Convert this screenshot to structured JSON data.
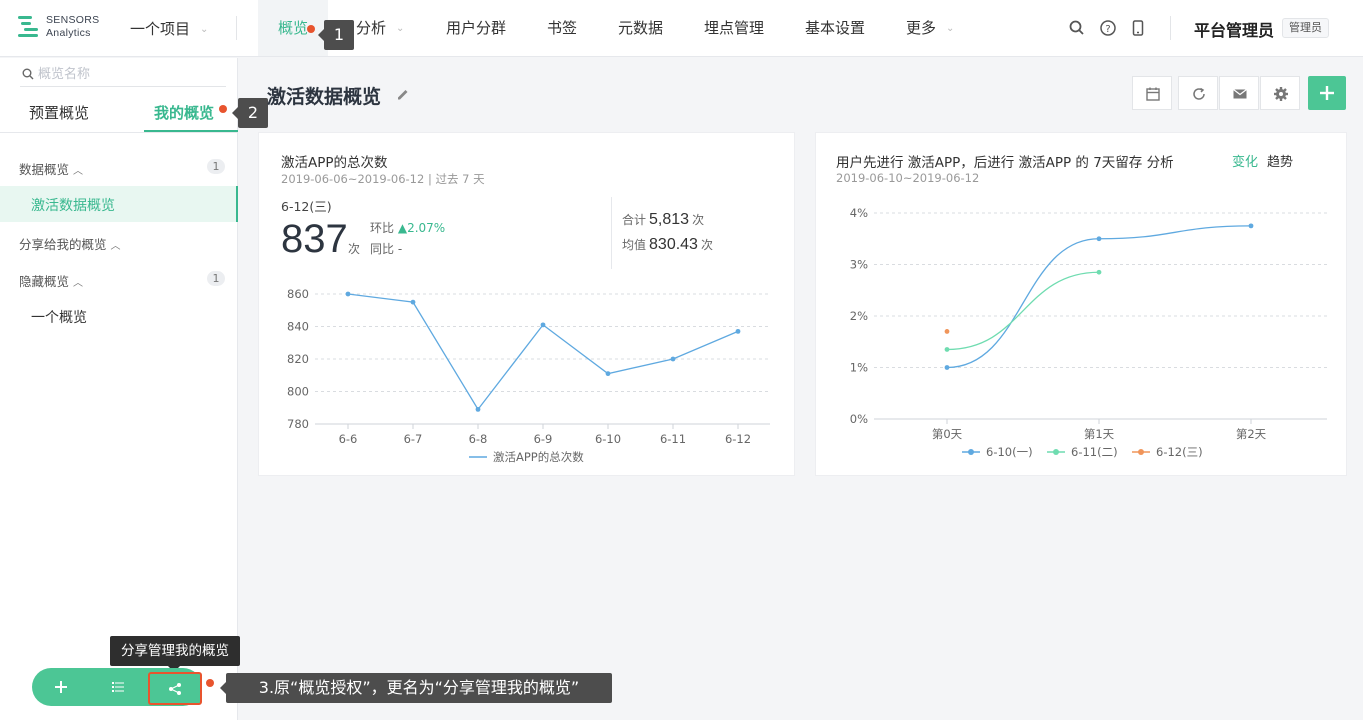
{
  "brand": {
    "line1": "SENSORS",
    "line2": "Analytics",
    "color": "#39b88f"
  },
  "header": {
    "project": "一个项目",
    "nav": [
      "概览",
      "分析",
      "用户分群",
      "书签",
      "元数据",
      "埋点管理",
      "基本设置",
      "更多"
    ],
    "icons": [
      "search-icon",
      "help-icon",
      "mobile-icon"
    ],
    "user": "平台管理员",
    "role": "管理员"
  },
  "annotations": {
    "one": "1",
    "two": "2",
    "three": "3.原“概览授权”，更名为“分享管理我的概览”",
    "tooltip": "分享管理我的概览"
  },
  "sidebar": {
    "search_placeholder": "概览名称",
    "tabs": [
      "预置概览",
      "我的概览"
    ],
    "groups": [
      {
        "label": "数据概览",
        "count": "1",
        "items": [
          "激活数据概览"
        ]
      },
      {
        "label": "分享给我的概览",
        "count": "",
        "items": []
      },
      {
        "label": "隐藏概览",
        "count": "1",
        "items": [
          "一个概览"
        ]
      }
    ]
  },
  "main": {
    "title": "激活数据概览",
    "toolbar": [
      "calendar-icon",
      "refresh-icon",
      "mail-icon",
      "gear-icon",
      "plus-icon"
    ]
  },
  "card1": {
    "title": "激活APP的总次数",
    "subtitle": "2019-06-06~2019-06-12 | 过去 7 天",
    "date": "6-12(三)",
    "value": "837",
    "unit": "次",
    "mom_label": "环比",
    "mom_value": "▲2.07%",
    "yoy": "同比 -",
    "total_label": "合计",
    "total": "5,813",
    "avg_label": "均值",
    "avg": "830.43"
  },
  "card2": {
    "title": "用户先进行 激活APP，后进行 激活APP 的 7天留存 分析",
    "subtitle": "2019-06-10~2019-06-12",
    "toggle": [
      "变化",
      "趋势"
    ]
  },
  "chart_data": [
    {
      "type": "line",
      "categories": [
        "6-6",
        "6-7",
        "6-8",
        "6-9",
        "6-10",
        "6-11",
        "6-12"
      ],
      "series": [
        {
          "name": "激活APP的总次数",
          "values": [
            860,
            855,
            789,
            841,
            811,
            820,
            837
          ],
          "color": "#5fa9e0"
        }
      ],
      "ylim": [
        780,
        860
      ],
      "yticks": [
        "860",
        "840",
        "820",
        "800",
        "780"
      ],
      "legend": "bottom",
      "grid": true
    },
    {
      "type": "line",
      "categories": [
        "第0天",
        "第1天",
        "第2天"
      ],
      "series": [
        {
          "name": "6-10(一)",
          "values": [
            1.0,
            3.5,
            3.75
          ],
          "color": "#5fa9e0"
        },
        {
          "name": "6-11(二)",
          "values": [
            1.35,
            2.85
          ],
          "color": "#6fdcb0"
        },
        {
          "name": "6-12(三)",
          "values": [
            1.7
          ],
          "color": "#f0955a"
        }
      ],
      "ylim": [
        0,
        4
      ],
      "yticks": [
        "4%",
        "3%",
        "2%",
        "1%",
        "0%"
      ],
      "legend": "bottom",
      "grid": true
    }
  ]
}
